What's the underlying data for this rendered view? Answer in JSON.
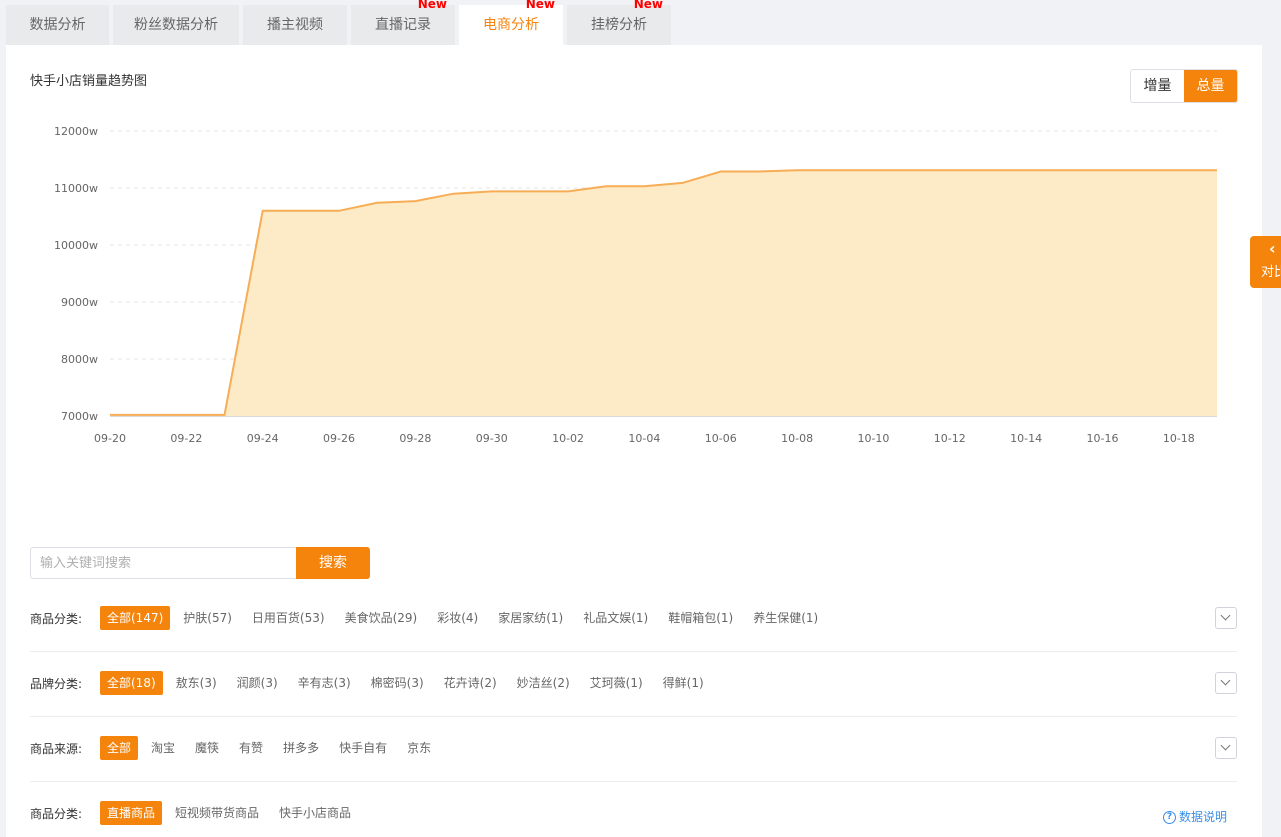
{
  "tabs": [
    {
      "label": "数据分析",
      "new": ""
    },
    {
      "label": "粉丝数据分析",
      "new": ""
    },
    {
      "label": "播主视频",
      "new": ""
    },
    {
      "label": "直播记录",
      "new": "New"
    },
    {
      "label": "电商分析",
      "new": "New"
    },
    {
      "label": "挂榜分析",
      "new": "New"
    }
  ],
  "chart_title": "快手小店销量趋势图",
  "toggle": {
    "increment": "增量",
    "total": "总量"
  },
  "side_tab": {
    "label": "对比"
  },
  "chart_data": {
    "type": "area",
    "title": "",
    "xlabel": "",
    "ylabel": "",
    "ylim": [
      7000,
      12000
    ],
    "y_ticks": [
      "7000w",
      "8000w",
      "9000w",
      "10000w",
      "11000w",
      "12000w"
    ],
    "x_ticks": [
      "09-20",
      "09-22",
      "09-24",
      "09-26",
      "09-28",
      "09-30",
      "10-02",
      "10-04",
      "10-06",
      "10-08",
      "10-10",
      "10-12",
      "10-14",
      "10-16",
      "10-18"
    ],
    "x": [
      "09-20",
      "09-21",
      "09-22",
      "09-23",
      "09-24",
      "09-25",
      "09-26",
      "09-27",
      "09-28",
      "09-29",
      "09-30",
      "10-01",
      "10-02",
      "10-03",
      "10-04",
      "10-05",
      "10-06",
      "10-07",
      "10-08",
      "10-09",
      "10-10",
      "10-11",
      "10-12",
      "10-13",
      "10-14",
      "10-15",
      "10-16",
      "10-17",
      "10-18",
      "10-19"
    ],
    "series": [
      {
        "values": [
          7020,
          7020,
          7020,
          7020,
          10600,
          10600,
          10600,
          10740,
          10770,
          10900,
          10940,
          10940,
          10940,
          11030,
          11030,
          11090,
          11290,
          11290,
          11310,
          11310,
          11310,
          11310,
          11310,
          11310,
          11310,
          11310,
          11310,
          11310,
          11310,
          11310
        ]
      }
    ],
    "grid": true,
    "colors": {
      "line": "#f7ad55",
      "fill": "#fdebc8"
    }
  },
  "search": {
    "placeholder": "输入关键词搜索",
    "button": "搜索"
  },
  "filters": [
    {
      "label": "商品分类:",
      "options": [
        "全部(147)",
        "护肤(57)",
        "日用百货(53)",
        "美食饮品(29)",
        "彩妆(4)",
        "家居家纺(1)",
        "礼品文娱(1)",
        "鞋帽箱包(1)",
        "养生保健(1)"
      ],
      "active": 0,
      "expand": true
    },
    {
      "label": "品牌分类:",
      "options": [
        "全部(18)",
        "敖东(3)",
        "润颜(3)",
        "辛有志(3)",
        "棉密码(3)",
        "花卉诗(2)",
        "妙洁丝(2)",
        "艾珂薇(1)",
        "得鲜(1)"
      ],
      "active": 0,
      "expand": true
    },
    {
      "label": "商品来源:",
      "options": [
        "全部",
        "淘宝",
        "魔筷",
        "有赞",
        "拼多多",
        "快手自有",
        "京东"
      ],
      "active": 0,
      "expand": true
    },
    {
      "label": "商品分类:",
      "options": [
        "直播商品",
        "短视频带货商品",
        "快手小店商品"
      ],
      "active": 0,
      "expand": false
    }
  ],
  "help": "数据说明",
  "colors": {
    "accent": "#f5840c",
    "new_badge": "#ff0000",
    "link": "#3a8ee6"
  }
}
